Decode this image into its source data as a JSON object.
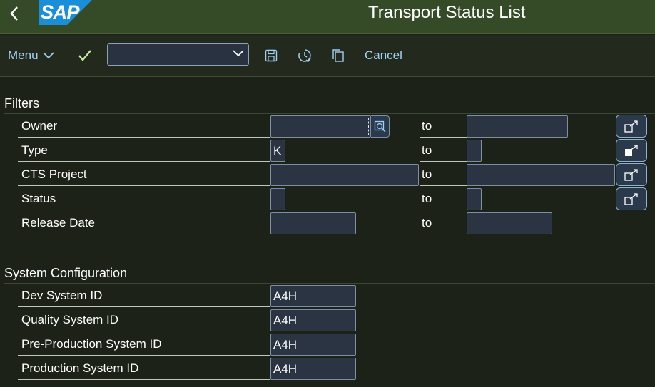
{
  "header": {
    "logo_text": "SAP",
    "title": "Transport Status List"
  },
  "toolbar": {
    "menu_label": "Menu",
    "okcode_value": "",
    "cancel_label": "Cancel"
  },
  "filters": {
    "title": "Filters",
    "to_label": "to",
    "rows": [
      {
        "label": "Owner",
        "from": "",
        "to": ""
      },
      {
        "label": "Type",
        "from": "K",
        "to": ""
      },
      {
        "label": "CTS Project",
        "from": "",
        "to": ""
      },
      {
        "label": "Status",
        "from": "",
        "to": ""
      },
      {
        "label": "Release Date",
        "from": "",
        "to": ""
      }
    ]
  },
  "system_config": {
    "title": "System Configuration",
    "rows": [
      {
        "label": "Dev System ID",
        "value": "A4H"
      },
      {
        "label": "Quality System ID",
        "value": "A4H"
      },
      {
        "label": "Pre-Production System ID",
        "value": "A4H"
      },
      {
        "label": "Production System ID",
        "value": "A4H"
      }
    ]
  },
  "colors": {
    "header_bg": "#354a26",
    "body_bg": "#1c2218",
    "link": "#9fd0f5",
    "input_bg": "#2a3443"
  }
}
